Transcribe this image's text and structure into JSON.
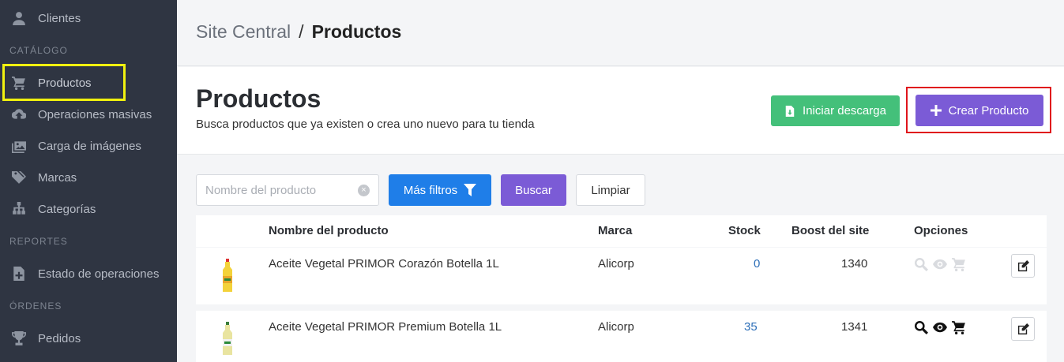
{
  "sidebar": {
    "items": [
      {
        "label": "Clientes",
        "icon": "user-icon"
      },
      {
        "label": "Productos",
        "icon": "cart-icon"
      },
      {
        "label": "Operaciones masivas",
        "icon": "cloud-upload-icon"
      },
      {
        "label": "Carga de imágenes",
        "icon": "images-icon"
      },
      {
        "label": "Marcas",
        "icon": "tags-icon"
      },
      {
        "label": "Categorías",
        "icon": "sitemap-icon"
      },
      {
        "label": "Estado de operaciones",
        "icon": "file-plus-icon"
      },
      {
        "label": "Pedidos",
        "icon": "trophy-icon"
      }
    ],
    "sections": {
      "catalogo": "CATÁLOGO",
      "reportes": "REPORTES",
      "ordenes": "ÓRDENES"
    }
  },
  "breadcrumb": {
    "parent": "Site Central",
    "separator": "/",
    "current": "Productos"
  },
  "header": {
    "title": "Productos",
    "subtitle": "Busca productos que ya existen o crea uno nuevo para tu tienda",
    "download_label": "Iniciar descarga",
    "create_label": "Crear Producto"
  },
  "filters": {
    "search_placeholder": "Nombre del producto",
    "more_filters_label": "Más filtros",
    "search_label": "Buscar",
    "clear_label": "Limpiar"
  },
  "table": {
    "headers": {
      "name": "Nombre del producto",
      "brand": "Marca",
      "stock": "Stock",
      "boost": "Boost del site",
      "options": "Opciones"
    },
    "rows": [
      {
        "name": "Aceite Vegetal PRIMOR Corazón Botella 1L",
        "brand": "Alicorp",
        "stock": "0",
        "boost": "1340",
        "options_enabled": false
      },
      {
        "name": "Aceite Vegetal PRIMOR Premium Botella 1L",
        "brand": "Alicorp",
        "stock": "35",
        "boost": "1341",
        "options_enabled": true
      }
    ]
  },
  "colors": {
    "sidebar_bg": "#2f3542",
    "download_green": "#44c07a",
    "create_purple": "#7b5bd6",
    "filters_blue": "#1f7ee8",
    "stock_link": "#2d6fb8",
    "highlight_yellow": "#f1f10f",
    "highlight_red": "#e0141c"
  }
}
